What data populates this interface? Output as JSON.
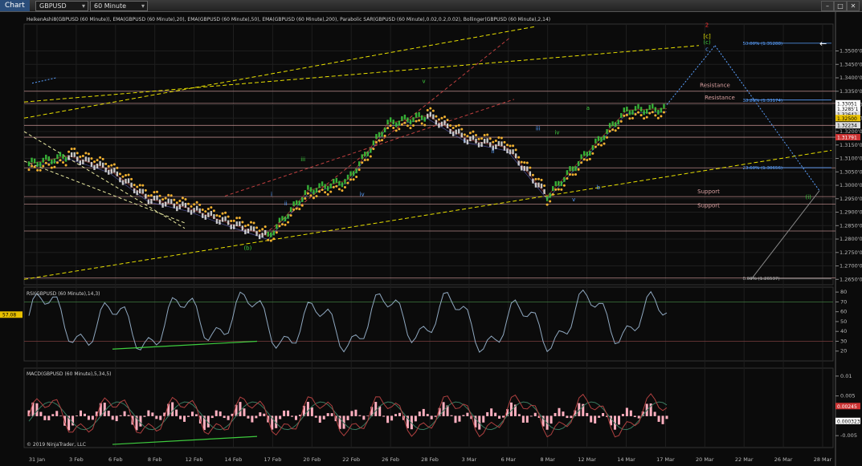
{
  "toolbar": {
    "tab_label": "Chart",
    "instrument": "GBPUSD",
    "timeframe": "60 Minute",
    "window_buttons": [
      "–",
      "□",
      "✕"
    ]
  },
  "price_panel": {
    "indicator_label": "HeikenAshi8(GBPUSD (60 Minute)), EMA(GBPUSD (60 Minute),20), EMA(GBPUSD (60 Minute),50), EMA(GBPUSD (60 Minute),200), Parabolic SAR(GBPUSD (60 Minute),0.02,0.2,0.02), Bollinger(GBPUSD (60 Minute),2,14)",
    "y_ticks": [
      "1.3500'0",
      "1.3450'0",
      "1.3400'0",
      "1.3350'0",
      "1.3300'0",
      "1.3250'0",
      "1.3200'0",
      "1.3150'0",
      "1.3100'0",
      "1.3050'0",
      "1.3000'0",
      "1.2950'0",
      "1.2900'0",
      "1.2850'0",
      "1.2800'0",
      "1.2750'0",
      "1.2700'0",
      "1.2650'0"
    ],
    "price_tags": [
      {
        "text": "1.33051",
        "bg": "#ffffff",
        "fg": "#000000",
        "y": 1.33051
      },
      {
        "text": "1.3285'1",
        "bg": "#ffffff",
        "fg": "#000000",
        "y": 1.3285
      },
      {
        "text": "1.32642",
        "bg": "#dddddd",
        "fg": "#000000",
        "y": 1.32642
      },
      {
        "text": "1.32500",
        "bg": "#e8c000",
        "fg": "#000000",
        "y": 1.325
      },
      {
        "text": "1.32234",
        "bg": "#dddddd",
        "fg": "#000000",
        "y": 1.32234
      },
      {
        "text": "1.31791",
        "bg": "#cc3333",
        "fg": "#ffffff",
        "y": 1.31791
      }
    ],
    "h_lines": [
      1.335,
      1.3305,
      1.3223,
      1.3179,
      1.3065,
      1.2958,
      1.293,
      1.283,
      1.2655
    ],
    "labels": [
      {
        "text": "Resistance",
        "x": 1.42,
        "y": 1.3365,
        "color": "#d9a0a0"
      },
      {
        "text": "Resistance",
        "x": 1.43,
        "y": 1.332,
        "color": "#d9a0a0"
      },
      {
        "text": "Support",
        "x": 1.415,
        "y": 1.297,
        "color": "#d9a0a0"
      },
      {
        "text": "Support",
        "x": 1.415,
        "y": 1.2918,
        "color": "#d9a0a0"
      }
    ],
    "fib_labels": [
      {
        "text": "50.00% (1.35288)",
        "x": 1.51,
        "y": 1.3529,
        "color": "#5aa0ff"
      },
      {
        "text": "38.20% (1.33174)",
        "x": 1.51,
        "y": 1.3317,
        "color": "#5aa0ff"
      },
      {
        "text": "23.60% (1.30656)",
        "x": 1.51,
        "y": 1.3066,
        "color": "#5aa0ff"
      },
      {
        "text": "0.00% (1.26537)",
        "x": 1.51,
        "y": 1.2654,
        "color": "#aaaaaa"
      }
    ],
    "wave_labels": [
      {
        "text": "(b)",
        "x": 0.47,
        "y": 1.276,
        "color": "#3ecc3e"
      },
      {
        "text": "i",
        "x": 0.52,
        "y": 1.296,
        "color": "#5aa0ff"
      },
      {
        "text": "ii",
        "x": 0.55,
        "y": 1.2925,
        "color": "#5aa0ff"
      },
      {
        "text": "iii",
        "x": 0.586,
        "y": 1.309,
        "color": "#3ecc3e"
      },
      {
        "text": "iv",
        "x": 0.71,
        "y": 1.296,
        "color": "#5aa0ff"
      },
      {
        "text": "v",
        "x": 0.84,
        "y": 1.338,
        "color": "#3ecc3e"
      },
      {
        "text": "i",
        "x": 0.925,
        "y": 1.316,
        "color": "#5aa0ff"
      },
      {
        "text": "ii",
        "x": 0.985,
        "y": 1.312,
        "color": "#5aa0ff"
      },
      {
        "text": "iii",
        "x": 1.08,
        "y": 1.3205,
        "color": "#5aa0ff"
      },
      {
        "text": "iv",
        "x": 1.12,
        "y": 1.319,
        "color": "#3ecc3e"
      },
      {
        "text": "v",
        "x": 1.155,
        "y": 1.294,
        "color": "#5aa0ff"
      },
      {
        "text": "a",
        "x": 1.185,
        "y": 1.328,
        "color": "#3ecc3e"
      },
      {
        "text": "b",
        "x": 1.207,
        "y": 1.2985,
        "color": "#5aa0ff"
      },
      {
        "text": "c",
        "x": 1.435,
        "y": 1.35,
        "color": "#5aa0ff"
      },
      {
        "text": "[c]",
        "x": 1.435,
        "y": 1.3548,
        "color": "#e8e800"
      },
      {
        "text": "(c)",
        "x": 1.435,
        "y": 1.3525,
        "color": "#3ecc3e"
      },
      {
        "text": "2",
        "x": 1.435,
        "y": 1.359,
        "color": "#ff3030"
      },
      {
        "text": "(i)",
        "x": 1.648,
        "y": 1.295,
        "color": "#3ecc3e"
      }
    ]
  },
  "rsi_panel": {
    "label": "RSI(GBPUSD (60 Minute),14,3)",
    "y_ticks": [
      "80",
      "70",
      "60",
      "50",
      "40",
      "30",
      "20"
    ],
    "value_tag": "57.08"
  },
  "macd_panel": {
    "label": "MACD(GBPUSD (60 Minute),5,34,5)",
    "y_ticks": [
      "0.01",
      "0.005",
      "-0.005"
    ],
    "value_tags": [
      "0.00245",
      "0.000323"
    ],
    "copyright": "© 2019 NinjaTrader, LLC"
  },
  "x_axis": {
    "ticks": [
      "31 Jan",
      "3 Feb",
      "6 Feb",
      "8 Feb",
      "12 Feb",
      "14 Feb",
      "17 Feb",
      "20 Feb",
      "22 Feb",
      "26 Feb",
      "28 Feb",
      "3 Mar",
      "6 Mar",
      "8 Mar",
      "12 Mar",
      "14 Mar",
      "17 Mar",
      "20 Mar",
      "22 Mar",
      "26 Mar",
      "28 Mar"
    ]
  },
  "colors": {
    "background": "#0b0b0b",
    "grid": "#1f1f1f",
    "ha_up": "#3ecc3e",
    "ha_down": "#e8e8e8",
    "sar": "#f0b030",
    "trend_yellow": "#e8e000",
    "trend_red": "#c04040",
    "resistance_line": "#d9a0a0",
    "fib_blue": "#5aa0ff",
    "rsi_line": "#8fa8c0",
    "macd_line": "#b04040",
    "macd_signal": "#3a7a60",
    "macd_hist": "#ffb0c0",
    "divergence": "#3ecc3e"
  },
  "chart_data": {
    "type": "line",
    "title": "GBPUSD",
    "xlabel": "",
    "ylabel": "",
    "ylim": [
      1.263,
      1.36
    ],
    "x": [
      "31 Jan",
      "3 Feb",
      "6 Feb",
      "8 Feb",
      "12 Feb",
      "14 Feb",
      "17 Feb",
      "20 Feb",
      "22 Feb",
      "26 Feb",
      "28 Feb",
      "3 Mar",
      "6 Mar",
      "8 Mar",
      "12 Mar",
      "14 Mar",
      "17 Mar"
    ],
    "series": [
      {
        "values": [
          1.308,
          1.311,
          1.306,
          1.295,
          1.2915,
          1.286,
          1.281,
          1.298,
          1.302,
          1.323,
          1.326,
          1.317,
          1.314,
          1.296,
          1.312,
          1.328,
          1.3285
        ]
      }
    ]
  }
}
